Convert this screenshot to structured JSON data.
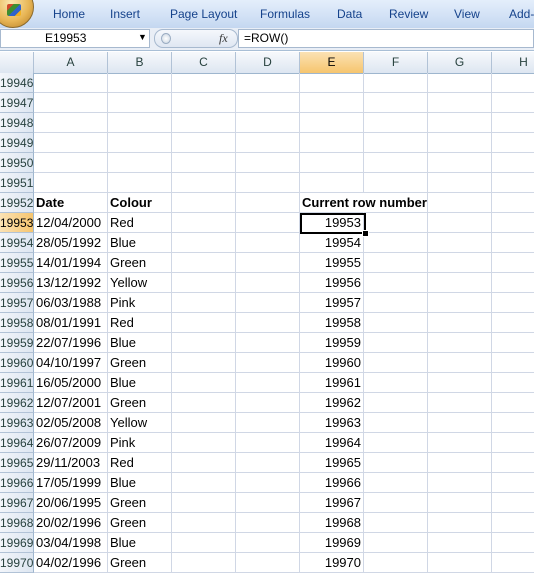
{
  "ribbon": {
    "tabs": [
      "Home",
      "Insert",
      "Page Layout",
      "Formulas",
      "Data",
      "Review",
      "View",
      "Add-"
    ]
  },
  "formula_bar": {
    "name_box": "E19953",
    "fx_label": "fx",
    "formula": "=ROW()"
  },
  "columns": [
    "A",
    "B",
    "C",
    "D",
    "E",
    "F",
    "G",
    "H"
  ],
  "selected_column": "E",
  "selected_row": "19953",
  "empty_rows": [
    "19946",
    "19947",
    "19948",
    "19949",
    "19950",
    "19951"
  ],
  "header_row": {
    "row": "19952",
    "date": "Date",
    "colour": "Colour",
    "current_row": "Current row number"
  },
  "data_rows": [
    {
      "row": "19953",
      "date": "12/04/2000",
      "colour": "Red",
      "current": "19953"
    },
    {
      "row": "19954",
      "date": "28/05/1992",
      "colour": "Blue",
      "current": "19954"
    },
    {
      "row": "19955",
      "date": "14/01/1994",
      "colour": "Green",
      "current": "19955"
    },
    {
      "row": "19956",
      "date": "13/12/1992",
      "colour": "Yellow",
      "current": "19956"
    },
    {
      "row": "19957",
      "date": "06/03/1988",
      "colour": "Pink",
      "current": "19957"
    },
    {
      "row": "19958",
      "date": "08/01/1991",
      "colour": "Red",
      "current": "19958"
    },
    {
      "row": "19959",
      "date": "22/07/1996",
      "colour": "Blue",
      "current": "19959"
    },
    {
      "row": "19960",
      "date": "04/10/1997",
      "colour": "Green",
      "current": "19960"
    },
    {
      "row": "19961",
      "date": "16/05/2000",
      "colour": "Blue",
      "current": "19961"
    },
    {
      "row": "19962",
      "date": "12/07/2001",
      "colour": "Green",
      "current": "19962"
    },
    {
      "row": "19963",
      "date": "02/05/2008",
      "colour": "Yellow",
      "current": "19963"
    },
    {
      "row": "19964",
      "date": "26/07/2009",
      "colour": "Pink",
      "current": "19964"
    },
    {
      "row": "19965",
      "date": "29/11/2003",
      "colour": "Red",
      "current": "19965"
    },
    {
      "row": "19966",
      "date": "17/05/1999",
      "colour": "Blue",
      "current": "19966"
    },
    {
      "row": "19967",
      "date": "20/06/1995",
      "colour": "Green",
      "current": "19967"
    },
    {
      "row": "19968",
      "date": "20/02/1996",
      "colour": "Green",
      "current": "19968"
    },
    {
      "row": "19969",
      "date": "03/04/1998",
      "colour": "Blue",
      "current": "19969"
    },
    {
      "row": "19970",
      "date": "04/02/1996",
      "colour": "Green",
      "current": "19970"
    }
  ]
}
